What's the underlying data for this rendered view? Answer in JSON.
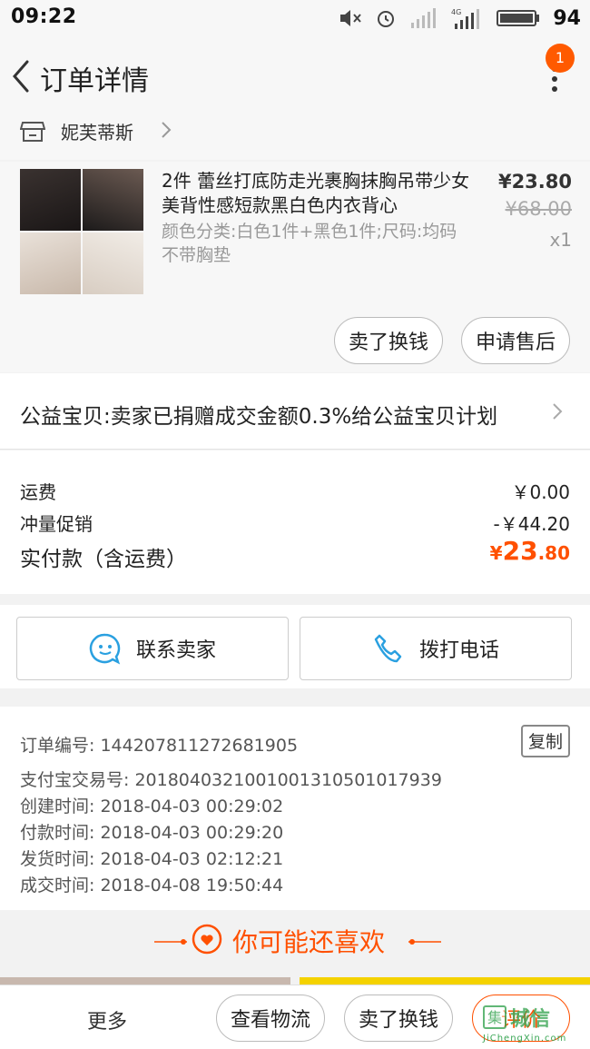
{
  "status_bar": {
    "time": "09:22",
    "battery": "94"
  },
  "header": {
    "title": "订单详情",
    "notification_count": "1"
  },
  "shop": {
    "name": "妮芙蒂斯"
  },
  "product": {
    "title": "2件 蕾丝打底防走光裹胸抹胸吊带少女美背性感短款黑白色内衣背心",
    "spec": "颜色分类:白色1件+黑色1件;尺码:均码 不带胸垫",
    "price": "¥23.80",
    "original_price": "¥68.00",
    "quantity": "x1",
    "actions": [
      "卖了换钱",
      "申请售后"
    ]
  },
  "charity": {
    "text": "公益宝贝:卖家已捐赠成交金额0.3%给公益宝贝计划"
  },
  "fees": {
    "shipping_label": "运费",
    "shipping_value": "￥0.00",
    "promo_label": "冲量促销",
    "promo_value": "-￥44.20",
    "paid_label": "实付款（含运费）",
    "paid_symbol": "¥",
    "paid_int": "23",
    "paid_dec": ".80"
  },
  "contact": {
    "seller_label": "联系卖家",
    "phone_label": "拨打电话"
  },
  "order_info": {
    "order_no": "订单编号: 144207811272681905",
    "copy_label": "复制",
    "alipay_no": "支付宝交易号: 2018040321001001310501017939",
    "created": "创建时间: 2018-04-03 00:29:02",
    "paid": "付款时间: 2018-04-03 00:29:20",
    "shipped": "发货时间: 2018-04-03 02:12:21",
    "completed": "成交时间: 2018-04-08 19:50:44"
  },
  "recommend": {
    "title": "你可能还喜欢"
  },
  "bottom_bar": {
    "more": "更多",
    "logistics": "查看物流",
    "resell": "卖了换钱",
    "review": "评价"
  },
  "watermark": {
    "text": "城信",
    "sub": "JiChengXin.com"
  },
  "colors": {
    "accent": "#ff5000",
    "badge": "#ff5a00",
    "link_blue": "#2aa0e0"
  }
}
